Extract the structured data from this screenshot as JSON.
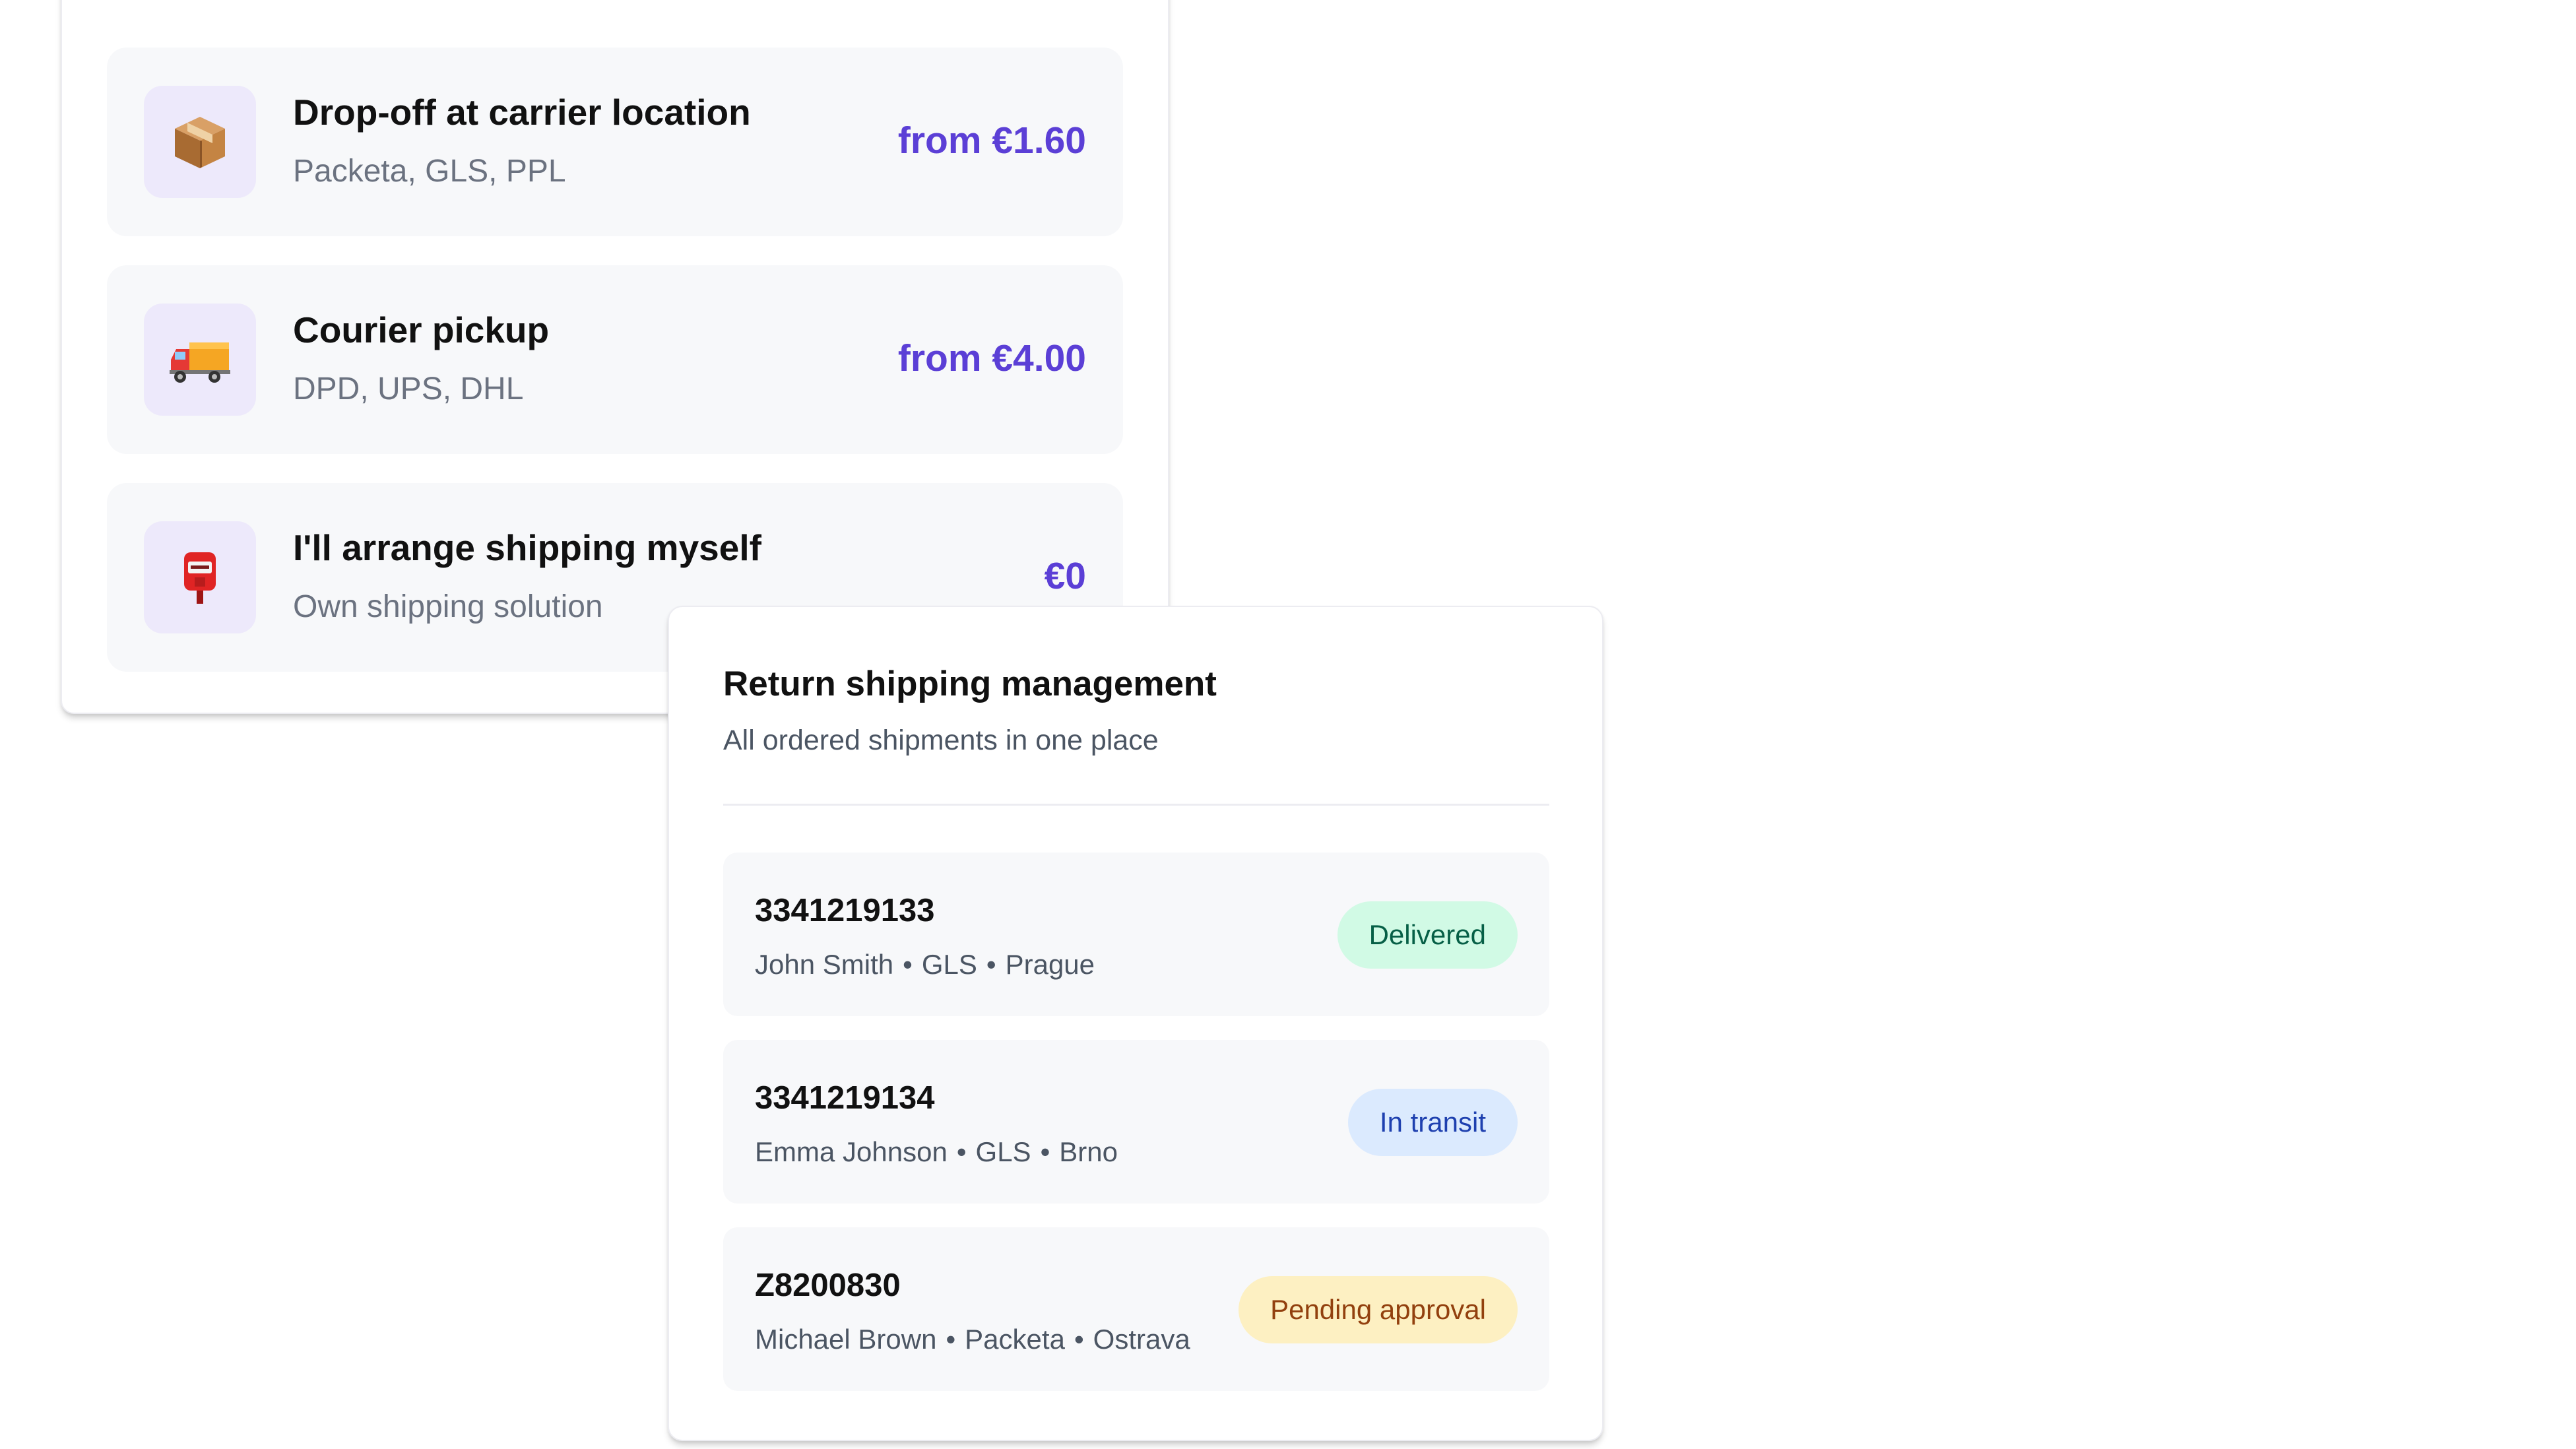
{
  "shipping_options": [
    {
      "icon": "package-icon",
      "title": "Drop-off at carrier location",
      "carriers": "Packeta, GLS, PPL",
      "price": "from €1.60"
    },
    {
      "icon": "delivery-truck-icon",
      "title": "Courier pickup",
      "carriers": "DPD, UPS, DHL",
      "price": "from €4.00"
    },
    {
      "icon": "postbox-icon",
      "title": "I'll arrange shipping myself",
      "carriers": "Own shipping solution",
      "price": "€0"
    }
  ],
  "returns": {
    "title": "Return shipping management",
    "subtitle": "All ordered shipments in one place",
    "separator": "•",
    "shipments": [
      {
        "tracking": "3341219133",
        "customer": "John Smith",
        "carrier": "GLS",
        "city": "Prague",
        "status": "Delivered"
      },
      {
        "tracking": "3341219134",
        "customer": "Emma Johnson",
        "carrier": "GLS",
        "city": "Brno",
        "status": "In transit"
      },
      {
        "tracking": "Z8200830",
        "customer": "Michael Brown",
        "carrier": "Packeta",
        "city": "Ostrava",
        "status": "Pending approval"
      }
    ]
  },
  "colors": {
    "accent": "#5b3fd6",
    "icon_tile": "#ede9fb",
    "card_surface": "#f7f8fa",
    "delivered_bg": "#d1fae5",
    "delivered_text": "#065f46",
    "transit_bg": "#dbeafe",
    "transit_text": "#1e40af",
    "pending_bg": "#fdf0c2",
    "pending_text": "#92400e"
  }
}
